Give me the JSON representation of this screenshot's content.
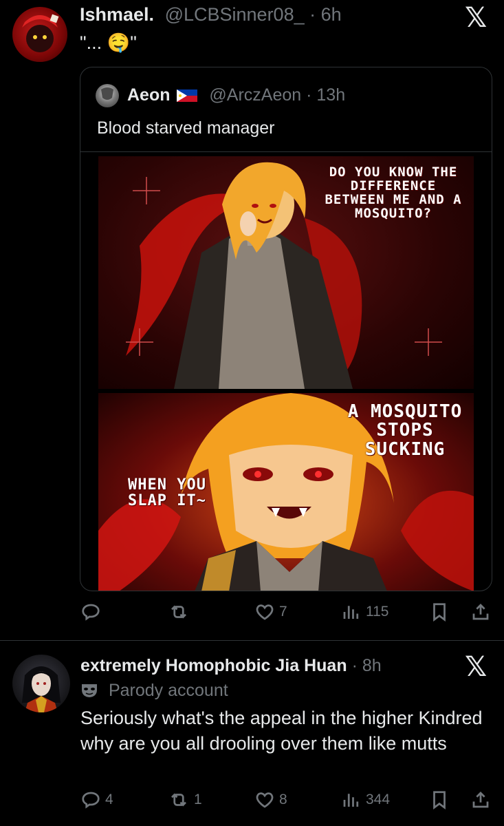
{
  "post1": {
    "display_name": "Ishmael.",
    "handle": "@LCBSinner08_",
    "time": "· 6h",
    "text": "\"... 🤤\"",
    "quote": {
      "display_name": "Aeon",
      "flag": "🇵🇭",
      "handle": "@ArczAeon",
      "time": "· 13h",
      "text": "Blood starved manager",
      "panel1_text": "DO YOU KNOW THE DIFFERENCE BETWEEN ME AND A MOSQUITO?",
      "panel2_text_right": "A MOSQUITO STOPS SUCKING",
      "panel2_text_left": "WHEN YOU SLAP IT~"
    },
    "actions": {
      "replies": "",
      "reposts": "",
      "likes": "7",
      "views": "115"
    }
  },
  "post2": {
    "display_name": "extremely Homophobic Jia Huan",
    "time": "· 8h",
    "parody_label": "Parody account",
    "text": "Seriously what's the appeal in the higher Kindred why are you all drooling over them like mutts",
    "actions": {
      "replies": "4",
      "reposts": "1",
      "likes": "8",
      "views": "344"
    }
  },
  "x_logo": "𝕏",
  "colors": {
    "background": "#000000",
    "text": "#e7e9ea",
    "muted": "#71767b",
    "divider": "#2f3336",
    "accent_red": "#8b0a0a"
  }
}
